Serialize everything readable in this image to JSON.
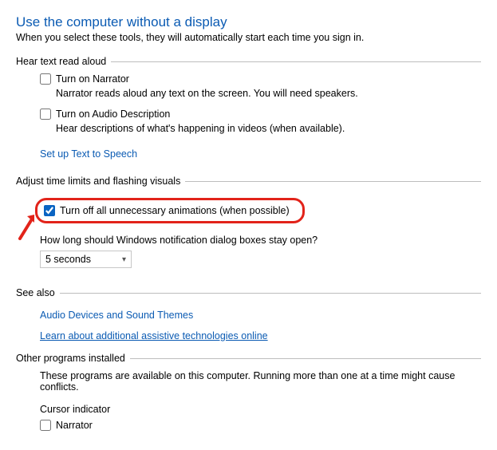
{
  "header": {
    "title": "Use the computer without a display",
    "subtitle": "When you select these tools, they will automatically start each time you sign in."
  },
  "group_hear": {
    "legend": "Hear text read aloud",
    "narrator_label": "Turn on Narrator",
    "narrator_desc": "Narrator reads aloud any text on the screen. You will need speakers.",
    "audio_desc_label": "Turn on Audio Description",
    "audio_desc_desc": "Hear descriptions of what's happening in videos (when available).",
    "tts_link": "Set up Text to Speech"
  },
  "group_time": {
    "legend": "Adjust time limits and flashing visuals",
    "anim_label": "Turn off all unnecessary animations (when possible)",
    "question": "How long should Windows notification dialog boxes stay open?",
    "select_value": "5 seconds"
  },
  "see_also": {
    "legend": "See also",
    "audio_link": "Audio Devices and Sound Themes",
    "learn_link": "Learn about additional assistive technologies online"
  },
  "other": {
    "legend": "Other programs installed",
    "desc": "These programs are available on this computer. Running more than one at a time might cause conflicts.",
    "cursor_label": "Cursor indicator",
    "narrator_cb": "Narrator"
  }
}
